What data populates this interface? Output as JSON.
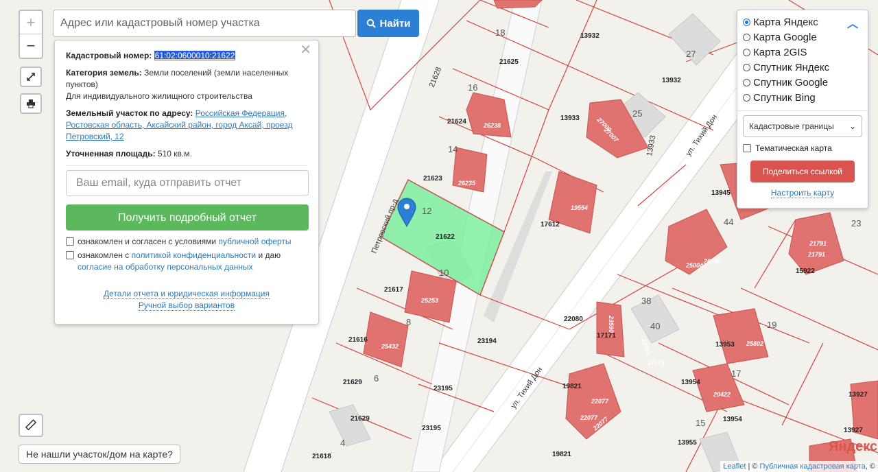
{
  "search": {
    "placeholder": "Адрес или кадастровый номер участка",
    "button_label": "Найти"
  },
  "info_card": {
    "cad_label": "Кадастровый номер:",
    "cad_number": "61:02:0600010:21622",
    "category_label": "Категория земель:",
    "category_value": "Земли поселений (земли населенных пунктов)",
    "use_value": "Для индивидуального жилищного строительства",
    "address_label": "Земельный участок по адресу:",
    "address_value": "Российская Федерация, Ростовская область, Аксайский район, город Аксай, проезд Петровский, 12",
    "area_label": "Уточненная площадь:",
    "area_value": "510 кв.м.",
    "email_placeholder": "Ваш email, куда отправить отчет",
    "report_button": "Получить подробный отчет",
    "agree1_text": "ознакомлен и согласен с условиями ",
    "agree1_link": "публичной оферты",
    "agree2_text": "ознакомлен с ",
    "agree2_link": "политикой конфиденциальности",
    "agree2_tail": " и даю",
    "agree2_link2": "согласие на обработку персональных данных",
    "details_link": "Детали отчета и юридическая информация",
    "manual_link": "Ручной выбор вариантов"
  },
  "layers": {
    "options": [
      {
        "label": "Карта Яндекс",
        "selected": true
      },
      {
        "label": "Карта Google",
        "selected": false
      },
      {
        "label": "Карта 2GIS",
        "selected": false
      },
      {
        "label": "Спутник Яндекс",
        "selected": false
      },
      {
        "label": "Спутник Google",
        "selected": false
      },
      {
        "label": "Спутник Bing",
        "selected": false
      }
    ],
    "select_value": "Кадастровые границы",
    "thematic_label": "Тематическая карта",
    "share_button": "Поделиться ссылкой",
    "setup_link": "Настроить карту"
  },
  "not_found_button": "Не нашли участок/дом на карте?",
  "attribution": {
    "leaflet": "Leaflet",
    "sep": " | © ",
    "source": "Публичная кадастровая карта",
    "tail": ", ©"
  },
  "yandex_logo": "Яндекс",
  "map_labels": {
    "parcels": [
      "21628",
      "21625",
      "21624",
      "21623",
      "21622",
      "21617",
      "21616",
      "21629",
      "21629",
      "21618",
      "13932",
      "13932",
      "13933",
      "17612",
      "22080",
      "17171",
      "23194",
      "23195",
      "23195",
      "19821",
      "19821",
      "13954",
      "13953",
      "13955",
      "13945",
      "13927",
      "13927",
      "15922"
    ],
    "buildings": [
      "26238",
      "26235",
      "25253",
      "25432",
      "19554",
      "27009",
      "27007",
      "25004",
      "26280",
      "21791",
      "21791",
      "25802",
      "20422",
      "22077",
      "22077",
      "22077",
      "23590",
      "23591",
      "17171",
      "13954",
      "13933"
    ],
    "house_numbers": [
      "18",
      "16",
      "14",
      "12",
      "10",
      "8",
      "6",
      "4",
      "27",
      "25",
      "44",
      "23",
      "38",
      "40",
      "19",
      "17",
      "15"
    ],
    "streets": [
      "Петровский пр-д",
      "ул. Тихий Дон",
      "ул. Тихий Дон"
    ]
  },
  "colors": {
    "parcel_line": "#d0453e",
    "building": "#e0736f",
    "selected_parcel": "#7ef0a0",
    "accent_blue": "#2b7fd4",
    "green_button": "#5cb85c",
    "red_button": "#d9534f"
  }
}
